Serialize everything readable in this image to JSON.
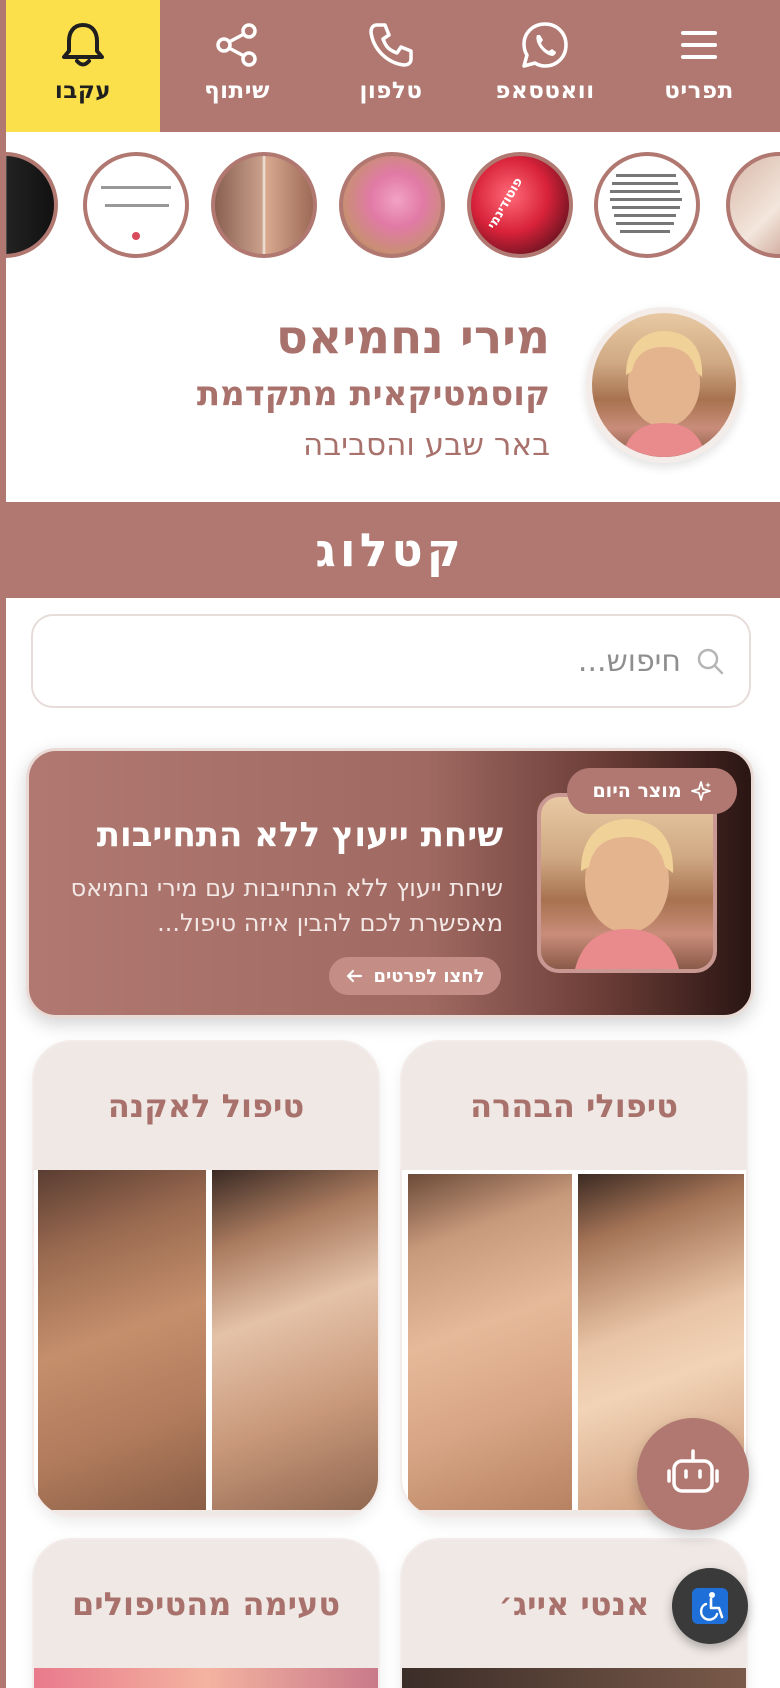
{
  "nav": {
    "menu_label": "תפריט",
    "whatsapp_label": "וואטסאפ",
    "phone_label": "טלפון",
    "share_label": "שיתוף",
    "follow_label": "עקבו"
  },
  "stories": [
    {
      "name": "story-1",
      "caption": ""
    },
    {
      "name": "story-2",
      "caption": ""
    },
    {
      "name": "story-3",
      "caption": "פוטודינמי"
    },
    {
      "name": "story-4",
      "caption": ""
    },
    {
      "name": "story-5",
      "caption": ""
    },
    {
      "name": "story-6",
      "caption": ""
    },
    {
      "name": "story-7",
      "caption": ""
    }
  ],
  "profile": {
    "name": "מירי נחמיאס",
    "title": "קוסמטיקאית מתקדמת",
    "area": "באר שבע והסביבה"
  },
  "catalog": {
    "title": "קטלוג",
    "search_placeholder": "חיפוש..."
  },
  "featured": {
    "badge": "מוצר היום",
    "title": "שיחת ייעוץ ללא התחייבות",
    "description": "שיחת ייעוץ ללא התחייבות עם מירי נחמיאס מאפשרת לכם להבין איזה טיפול...",
    "cta": "לחצו לפרטים"
  },
  "categories": [
    {
      "title": "טיפולי הבהרה"
    },
    {
      "title": "טיפול לאקנה"
    },
    {
      "title": "אנטי אייג׳"
    },
    {
      "title": "טעימה מהטיפולים"
    }
  ],
  "colors": {
    "brand": "#b07870",
    "accent_yellow": "#fbe04c",
    "text_brand": "#a9716b"
  }
}
